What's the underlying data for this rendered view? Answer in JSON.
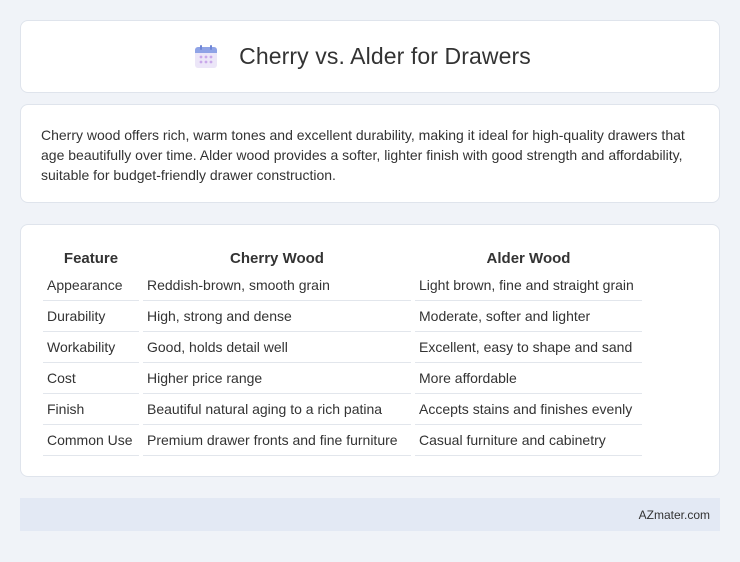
{
  "header": {
    "title": "Cherry vs. Alder for Drawers",
    "icon": "calendar-icon"
  },
  "summary": {
    "text": "Cherry wood offers rich, warm tones and excellent durability, making it ideal for high-quality drawers that age beautifully over time. Alder wood provides a softer, lighter finish with good strength and affordability, suitable for budget-friendly drawer construction."
  },
  "table": {
    "headers": [
      "Feature",
      "Cherry Wood",
      "Alder Wood"
    ],
    "rows": [
      [
        "Appearance",
        "Reddish-brown, smooth grain",
        "Light brown, fine and straight grain"
      ],
      [
        "Durability",
        "High, strong and dense",
        "Moderate, softer and lighter"
      ],
      [
        "Workability",
        "Good, holds detail well",
        "Excellent, easy to shape and sand"
      ],
      [
        "Cost",
        "Higher price range",
        "More affordable"
      ],
      [
        "Finish",
        "Beautiful natural aging to a rich patina",
        "Accepts stains and finishes evenly"
      ],
      [
        "Common Use",
        "Premium drawer fronts and fine furniture",
        "Casual furniture and cabinetry"
      ]
    ]
  },
  "footer": {
    "text": "AZmater.com"
  },
  "colors": {
    "background": "#f0f3f8",
    "card": "#ffffff",
    "footer_bar": "#e3e9f4",
    "icon_top": "#8fa3e6",
    "icon_body": "#e6dff7",
    "icon_dots": "#c9a8ea"
  }
}
